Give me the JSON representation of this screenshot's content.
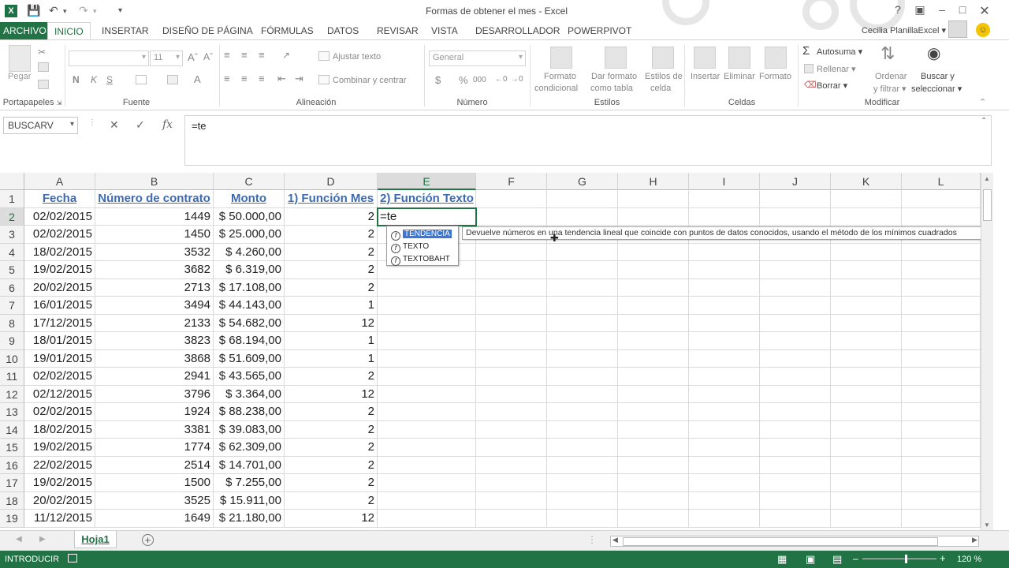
{
  "window": {
    "title": "Formas de obtener el mes - Excel",
    "help": "?",
    "user": "Cecilia PlanillaExcel"
  },
  "tabs": [
    "ARCHIVO",
    "INICIO",
    "INSERTAR",
    "DISEÑO DE PÁGINA",
    "FÓRMULAS",
    "DATOS",
    "REVISAR",
    "VISTA",
    "DESARROLLADOR",
    "POWERPIVOT"
  ],
  "ribbon": {
    "groups": {
      "clipboard": "Portapapeles",
      "font": "Fuente",
      "alignment": "Alineación",
      "number": "Número",
      "styles": "Estilos",
      "cells": "Celdas",
      "modify": "Modificar"
    },
    "paste": "Pegar",
    "font_size": "11",
    "bold": "N",
    "italic": "K",
    "underline": "S",
    "wrap_text": "Ajustar texto",
    "merge_center": "Combinar y centrar",
    "number_format": "General",
    "currency": "$",
    "percent": "%",
    "thousands": "000",
    "conditional_format_1": "Formato",
    "conditional_format_2": "condicional",
    "format_table_1": "Dar formato",
    "format_table_2": "como tabla",
    "cell_styles_1": "Estilos de",
    "cell_styles_2": "celda",
    "insert": "Insertar",
    "delete": "Eliminar",
    "format": "Formato",
    "autosum": "Autosuma",
    "fill": "Rellenar",
    "clear": "Borrar",
    "sort_1": "Ordenar",
    "sort_2": "y filtrar",
    "find_1": "Buscar y",
    "find_2": "seleccionar"
  },
  "formula_bar": {
    "name_box": "BUSCARV",
    "formula": "=te"
  },
  "columns": [
    "A",
    "B",
    "C",
    "D",
    "E",
    "F",
    "G",
    "H",
    "I",
    "J",
    "K",
    "L"
  ],
  "header_row": [
    "Fecha",
    "Número de contrato",
    "Monto",
    "1) Función Mes",
    "2) Función Texto"
  ],
  "rows": [
    {
      "n": "2",
      "a": "02/02/2015",
      "b": "1449",
      "c": "$ 50.000,00",
      "d": "2"
    },
    {
      "n": "3",
      "a": "02/02/2015",
      "b": "1450",
      "c": "$ 25.000,00",
      "d": "2"
    },
    {
      "n": "4",
      "a": "18/02/2015",
      "b": "3532",
      "c": "$ 4.260,00",
      "d": "2"
    },
    {
      "n": "5",
      "a": "19/02/2015",
      "b": "3682",
      "c": "$ 6.319,00",
      "d": "2"
    },
    {
      "n": "6",
      "a": "20/02/2015",
      "b": "2713",
      "c": "$ 17.108,00",
      "d": "2"
    },
    {
      "n": "7",
      "a": "16/01/2015",
      "b": "3494",
      "c": "$ 44.143,00",
      "d": "1"
    },
    {
      "n": "8",
      "a": "17/12/2015",
      "b": "2133",
      "c": "$ 54.682,00",
      "d": "12"
    },
    {
      "n": "9",
      "a": "18/01/2015",
      "b": "3823",
      "c": "$ 68.194,00",
      "d": "1"
    },
    {
      "n": "10",
      "a": "19/01/2015",
      "b": "3868",
      "c": "$ 51.609,00",
      "d": "1"
    },
    {
      "n": "11",
      "a": "02/02/2015",
      "b": "2941",
      "c": "$ 43.565,00",
      "d": "2"
    },
    {
      "n": "12",
      "a": "02/12/2015",
      "b": "3796",
      "c": "$ 3.364,00",
      "d": "12"
    },
    {
      "n": "13",
      "a": "02/02/2015",
      "b": "1924",
      "c": "$ 88.238,00",
      "d": "2"
    },
    {
      "n": "14",
      "a": "18/02/2015",
      "b": "3381",
      "c": "$ 39.083,00",
      "d": "2"
    },
    {
      "n": "15",
      "a": "19/02/2015",
      "b": "1774",
      "c": "$ 62.309,00",
      "d": "2"
    },
    {
      "n": "16",
      "a": "22/02/2015",
      "b": "2514",
      "c": "$ 14.701,00",
      "d": "2"
    },
    {
      "n": "17",
      "a": "19/02/2015",
      "b": "1500",
      "c": "$ 7.255,00",
      "d": "2"
    },
    {
      "n": "18",
      "a": "20/02/2015",
      "b": "3525",
      "c": "$ 15.911,00",
      "d": "2"
    },
    {
      "n": "19",
      "a": "11/12/2015",
      "b": "1649",
      "c": "$ 21.180,00",
      "d": "12"
    }
  ],
  "active_cell": {
    "value": "=te"
  },
  "autocomplete": {
    "items": [
      "TENDENCIA",
      "TEXTO",
      "TEXTOBAHT"
    ],
    "tooltip": "Devuelve números en una tendencia lineal que coincide con puntos de datos conocidos, usando el método de los mínimos cuadrados"
  },
  "sheet_tab": "Hoja1",
  "status": {
    "mode": "INTRODUCIR",
    "zoom": "120 %"
  },
  "colors": {
    "excel_green": "#217346",
    "header_text": "#3e6ab0",
    "highlight": "#3c77d6"
  }
}
